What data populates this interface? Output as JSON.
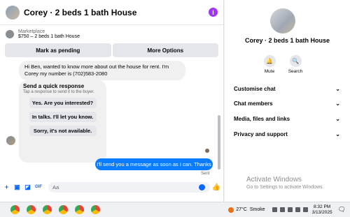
{
  "chat": {
    "title": "Corey · 2 beds 1 bath House",
    "marketplace_label": "Marketplace",
    "listing": "$750 – 2 beds 1 bath House",
    "actions": [
      "Mark as pending",
      "More Options"
    ],
    "incoming_message": "Hi Ben, wanted to know more about out the house for rent. I'm Corey my number is (702)583-2080",
    "quick_response": {
      "title": "Send a quick response",
      "subtitle": "Tap a response to send it to the buyer.",
      "options": [
        "Yes. Are you interested?",
        "In talks. I'll let you know.",
        "Sorry, it's not available."
      ]
    },
    "outgoing_message": "I'll send you a message as soon as I can. Thanks",
    "status": "Sent",
    "composer_placeholder": "Aa"
  },
  "panel": {
    "title": "Corey · 2 beds 1 bath House",
    "actions": [
      "Mute",
      "Search"
    ],
    "sections": [
      "Customise chat",
      "Chat members",
      "Media, files and links",
      "Privacy and support"
    ],
    "watermark_line1": "Activate Windows",
    "watermark_line2": "Go to Settings to activate Windows."
  },
  "taskbar": {
    "temperature": "27°C",
    "weather": "Smoke",
    "time": "8:32 PM",
    "date": "3/13/2025"
  },
  "icons": {
    "header": "info-icon",
    "composer": [
      "plus-icon",
      "image-icon",
      "sticker-icon",
      "gif-icon",
      "emoji-icon",
      "like-icon"
    ],
    "panel_actions": [
      "bell-icon",
      "search-icon"
    ]
  },
  "colors": {
    "accent": "#0a7cff",
    "info": "#a033ff"
  }
}
